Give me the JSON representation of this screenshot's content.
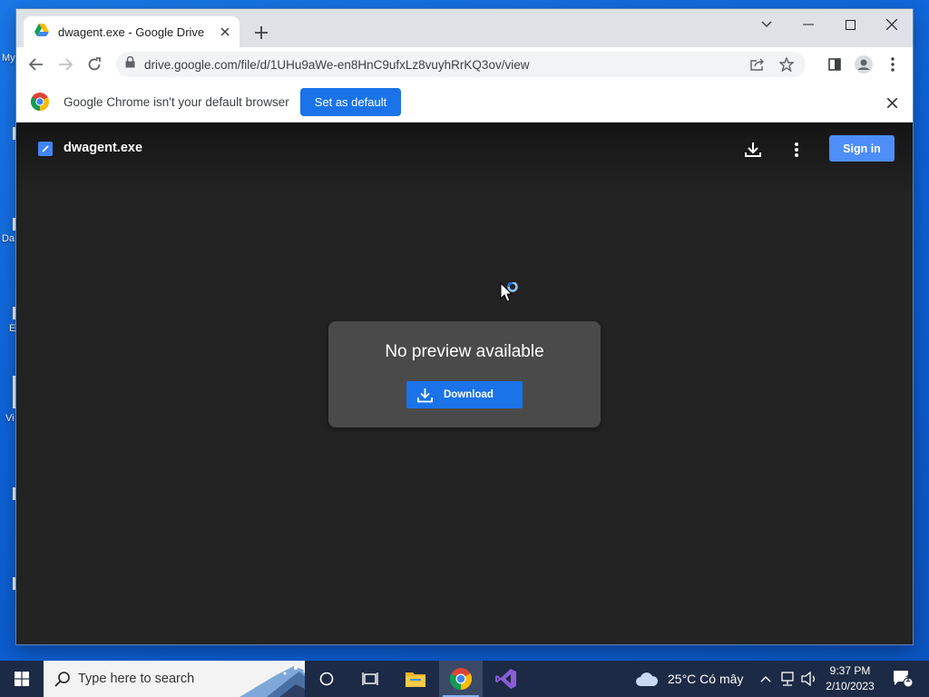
{
  "desktop": {
    "fragments": [
      "My",
      "Da",
      "E",
      "Vi"
    ]
  },
  "browser": {
    "tab_title": "dwagent.exe - Google Drive",
    "url": "drive.google.com/file/d/1UHu9aWe-en8HnC9ufxLz8vuyhRrKQ3ov/view",
    "infobar_message": "Google Chrome isn't your default browser",
    "set_default_label": "Set as default"
  },
  "drive": {
    "file_name": "dwagent.exe",
    "sign_in_label": "Sign in",
    "no_preview_text": "No preview available",
    "download_label": "Download"
  },
  "taskbar": {
    "search_placeholder": "Type here to search",
    "weather": "25°C  Có mây",
    "time": "9:37 PM",
    "date": "2/10/2023",
    "notification_count": "1"
  },
  "colors": {
    "accent": "#1a73e8",
    "signin": "#4d8ef8",
    "viewer_bg": "#232323",
    "taskbar_bg": "#1c2a45"
  }
}
